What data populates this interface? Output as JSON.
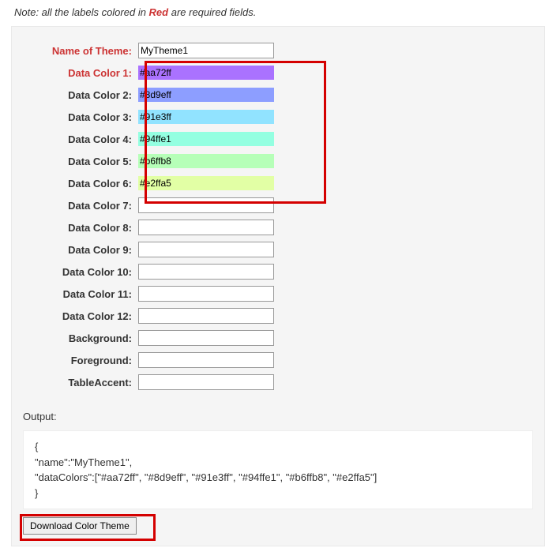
{
  "note": {
    "prefix": "Note: all the labels colored in ",
    "emph": "Red",
    "suffix": " are required fields."
  },
  "fields": {
    "name_label": "Name of Theme:",
    "name_value": "MyTheme1",
    "color_labels": {
      "c1": "Data Color 1:",
      "c2": "Data Color 2:",
      "c3": "Data Color 3:",
      "c4": "Data Color 4:",
      "c5": "Data Color 5:",
      "c6": "Data Color 6:",
      "c7": "Data Color 7:",
      "c8": "Data Color 8:",
      "c9": "Data Color 9:",
      "c10": "Data Color 10:",
      "c11": "Data Color 11:",
      "c12": "Data Color 12:"
    },
    "color_values": {
      "c1": "#aa72ff",
      "c2": "#8d9eff",
      "c3": "#91e3ff",
      "c4": "#94ffe1",
      "c5": "#b6ffb8",
      "c6": "#e2ffa5"
    },
    "background_label": "Background:",
    "foreground_label": "Foreground:",
    "tableaccent_label": "TableAccent:"
  },
  "output": {
    "label": "Output:",
    "line1": "{",
    "line2": "\"name\":\"MyTheme1\",",
    "line3": "\"dataColors\":[\"#aa72ff\", \"#8d9eff\", \"#91e3ff\", \"#94ffe1\", \"#b6ffb8\", \"#e2ffa5\"]",
    "line4": "}"
  },
  "download_label": "Download Color Theme"
}
